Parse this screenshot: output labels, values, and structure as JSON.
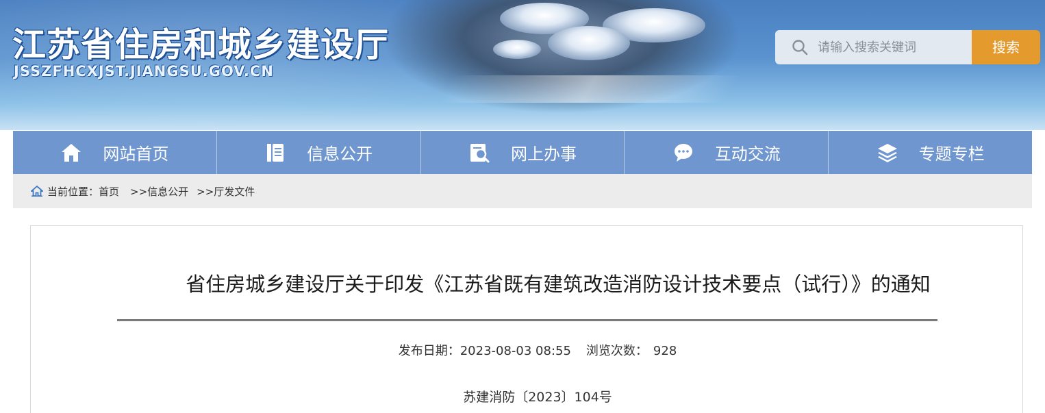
{
  "header": {
    "site_title": "江苏省住房和城乡建设厅",
    "site_domain": "JSSZFHCXJST.JIANGSU.GOV.CN",
    "search": {
      "placeholder": "请输入搜索关键词",
      "button_label": "搜索"
    }
  },
  "nav": {
    "items": [
      {
        "label": "网站首页",
        "icon": "home-icon"
      },
      {
        "label": "信息公开",
        "icon": "document-icon"
      },
      {
        "label": "网上办事",
        "icon": "search-document-icon"
      },
      {
        "label": "互动交流",
        "icon": "chat-icon"
      },
      {
        "label": "专题专栏",
        "icon": "layers-icon"
      }
    ]
  },
  "breadcrumb": {
    "prefix": "当前位置：",
    "items": [
      "首页",
      ">>信息公开",
      ">>厅发文件"
    ]
  },
  "article": {
    "title": "省住房城乡建设厅关于印发《江苏省既有建筑改造消防设计技术要点（试行）》的通知",
    "publish_label": "发布日期：",
    "publish_date": "2023-08-03 08:55",
    "views_label": "浏览次数：",
    "views": "928",
    "doc_number": "苏建消防〔2023〕104号"
  },
  "colors": {
    "nav_bg": "#6f96cf",
    "search_button": "#e49a2c",
    "breadcrumb_bg": "#ececec"
  }
}
